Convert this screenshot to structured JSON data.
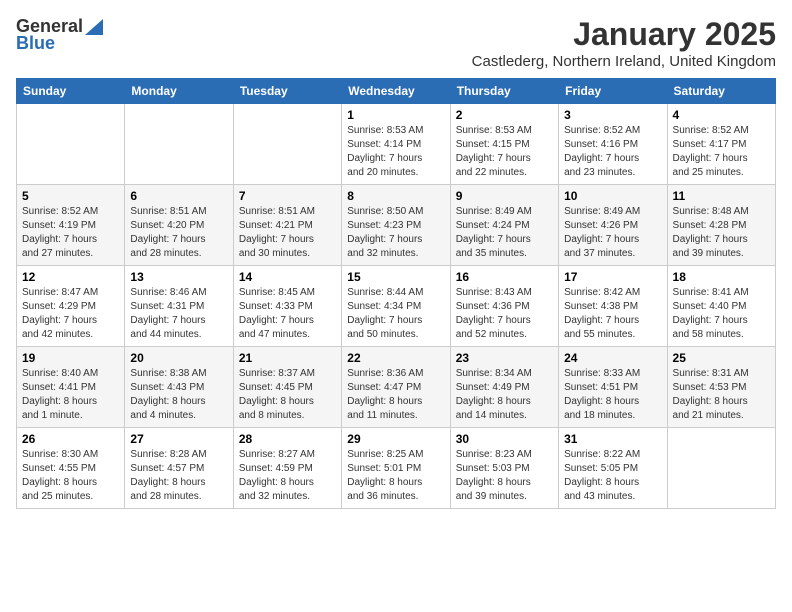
{
  "logo": {
    "general": "General",
    "blue": "Blue"
  },
  "title": "January 2025",
  "location": "Castlederg, Northern Ireland, United Kingdom",
  "days_of_week": [
    "Sunday",
    "Monday",
    "Tuesday",
    "Wednesday",
    "Thursday",
    "Friday",
    "Saturday"
  ],
  "weeks": [
    [
      {
        "day": "",
        "info": ""
      },
      {
        "day": "",
        "info": ""
      },
      {
        "day": "",
        "info": ""
      },
      {
        "day": "1",
        "info": "Sunrise: 8:53 AM\nSunset: 4:14 PM\nDaylight: 7 hours\nand 20 minutes."
      },
      {
        "day": "2",
        "info": "Sunrise: 8:53 AM\nSunset: 4:15 PM\nDaylight: 7 hours\nand 22 minutes."
      },
      {
        "day": "3",
        "info": "Sunrise: 8:52 AM\nSunset: 4:16 PM\nDaylight: 7 hours\nand 23 minutes."
      },
      {
        "day": "4",
        "info": "Sunrise: 8:52 AM\nSunset: 4:17 PM\nDaylight: 7 hours\nand 25 minutes."
      }
    ],
    [
      {
        "day": "5",
        "info": "Sunrise: 8:52 AM\nSunset: 4:19 PM\nDaylight: 7 hours\nand 27 minutes."
      },
      {
        "day": "6",
        "info": "Sunrise: 8:51 AM\nSunset: 4:20 PM\nDaylight: 7 hours\nand 28 minutes."
      },
      {
        "day": "7",
        "info": "Sunrise: 8:51 AM\nSunset: 4:21 PM\nDaylight: 7 hours\nand 30 minutes."
      },
      {
        "day": "8",
        "info": "Sunrise: 8:50 AM\nSunset: 4:23 PM\nDaylight: 7 hours\nand 32 minutes."
      },
      {
        "day": "9",
        "info": "Sunrise: 8:49 AM\nSunset: 4:24 PM\nDaylight: 7 hours\nand 35 minutes."
      },
      {
        "day": "10",
        "info": "Sunrise: 8:49 AM\nSunset: 4:26 PM\nDaylight: 7 hours\nand 37 minutes."
      },
      {
        "day": "11",
        "info": "Sunrise: 8:48 AM\nSunset: 4:28 PM\nDaylight: 7 hours\nand 39 minutes."
      }
    ],
    [
      {
        "day": "12",
        "info": "Sunrise: 8:47 AM\nSunset: 4:29 PM\nDaylight: 7 hours\nand 42 minutes."
      },
      {
        "day": "13",
        "info": "Sunrise: 8:46 AM\nSunset: 4:31 PM\nDaylight: 7 hours\nand 44 minutes."
      },
      {
        "day": "14",
        "info": "Sunrise: 8:45 AM\nSunset: 4:33 PM\nDaylight: 7 hours\nand 47 minutes."
      },
      {
        "day": "15",
        "info": "Sunrise: 8:44 AM\nSunset: 4:34 PM\nDaylight: 7 hours\nand 50 minutes."
      },
      {
        "day": "16",
        "info": "Sunrise: 8:43 AM\nSunset: 4:36 PM\nDaylight: 7 hours\nand 52 minutes."
      },
      {
        "day": "17",
        "info": "Sunrise: 8:42 AM\nSunset: 4:38 PM\nDaylight: 7 hours\nand 55 minutes."
      },
      {
        "day": "18",
        "info": "Sunrise: 8:41 AM\nSunset: 4:40 PM\nDaylight: 7 hours\nand 58 minutes."
      }
    ],
    [
      {
        "day": "19",
        "info": "Sunrise: 8:40 AM\nSunset: 4:41 PM\nDaylight: 8 hours\nand 1 minute."
      },
      {
        "day": "20",
        "info": "Sunrise: 8:38 AM\nSunset: 4:43 PM\nDaylight: 8 hours\nand 4 minutes."
      },
      {
        "day": "21",
        "info": "Sunrise: 8:37 AM\nSunset: 4:45 PM\nDaylight: 8 hours\nand 8 minutes."
      },
      {
        "day": "22",
        "info": "Sunrise: 8:36 AM\nSunset: 4:47 PM\nDaylight: 8 hours\nand 11 minutes."
      },
      {
        "day": "23",
        "info": "Sunrise: 8:34 AM\nSunset: 4:49 PM\nDaylight: 8 hours\nand 14 minutes."
      },
      {
        "day": "24",
        "info": "Sunrise: 8:33 AM\nSunset: 4:51 PM\nDaylight: 8 hours\nand 18 minutes."
      },
      {
        "day": "25",
        "info": "Sunrise: 8:31 AM\nSunset: 4:53 PM\nDaylight: 8 hours\nand 21 minutes."
      }
    ],
    [
      {
        "day": "26",
        "info": "Sunrise: 8:30 AM\nSunset: 4:55 PM\nDaylight: 8 hours\nand 25 minutes."
      },
      {
        "day": "27",
        "info": "Sunrise: 8:28 AM\nSunset: 4:57 PM\nDaylight: 8 hours\nand 28 minutes."
      },
      {
        "day": "28",
        "info": "Sunrise: 8:27 AM\nSunset: 4:59 PM\nDaylight: 8 hours\nand 32 minutes."
      },
      {
        "day": "29",
        "info": "Sunrise: 8:25 AM\nSunset: 5:01 PM\nDaylight: 8 hours\nand 36 minutes."
      },
      {
        "day": "30",
        "info": "Sunrise: 8:23 AM\nSunset: 5:03 PM\nDaylight: 8 hours\nand 39 minutes."
      },
      {
        "day": "31",
        "info": "Sunrise: 8:22 AM\nSunset: 5:05 PM\nDaylight: 8 hours\nand 43 minutes."
      },
      {
        "day": "",
        "info": ""
      }
    ]
  ]
}
